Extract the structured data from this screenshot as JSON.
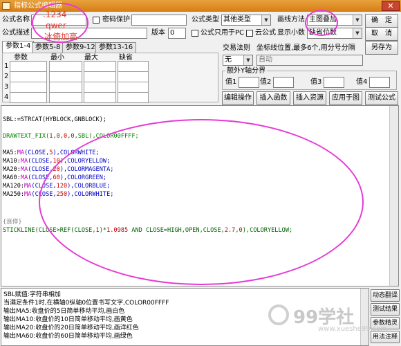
{
  "window": {
    "title": "指标公式编辑器",
    "close_label": "✕"
  },
  "header": {
    "name_label": "公式名称",
    "password_label": "密码保护",
    "desc_label": "公式描述",
    "version_label": "版本",
    "version_value": "0",
    "type_label": "公式类型",
    "type_value": "其他类型",
    "draw_label": "画线方法",
    "draw_value": "主图叠加",
    "pc_only_label": "公式只用于PC",
    "cloud_label": "云公式",
    "decimals_label": "显示小数",
    "decimals_value": "缺省位数",
    "ok_label": "确　定",
    "cancel_label": "取　消",
    "save_as_label": "另存为"
  },
  "params": {
    "tabs": [
      "参数1-4",
      "参数5-8",
      "参数9-12",
      "参数13-16"
    ],
    "headers": [
      "参数",
      "最小",
      "最大",
      "缺省"
    ],
    "rows": [
      "1",
      "2",
      "3",
      "4"
    ]
  },
  "trade": {
    "rule_label": "交易法则",
    "rule_value": "无",
    "coord_label": "坐标线位置,最多6个,用分号分隔",
    "coord_value": "自动",
    "extra_y_label": "额外Y轴分界",
    "value_labels": [
      "值1",
      "值2",
      "值3",
      "值4"
    ]
  },
  "toolbar": {
    "edit_ops": "编辑操作",
    "insert_func": "插入函数",
    "insert_res": "插入资源",
    "apply_chart": "应用于图",
    "test_formula": "测试公式"
  },
  "overlay": {
    "line1": ".1234",
    "line2": "qwer",
    "line3": "冰倚加高"
  },
  "code": {
    "l1": "SBL:=STRCAT(HYBLOCK,GNBLOCK);",
    "l2": [
      [
        "DRAWTEXT_FIX(",
        "green"
      ],
      [
        "1",
        "red"
      ],
      [
        ",",
        "green"
      ],
      [
        "0",
        "red"
      ],
      [
        ",",
        "green"
      ],
      [
        "0",
        "red"
      ],
      [
        ",",
        "green"
      ],
      [
        "0",
        "red"
      ],
      [
        ",SBL),COLOR00FFFF;",
        "green"
      ]
    ],
    "ma": [
      [
        [
          "MA5:",
          "black"
        ],
        [
          "MA",
          "mag"
        ],
        [
          "(CLOSE,",
          "blue"
        ],
        [
          "5",
          "red"
        ],
        [
          "),COLORWHITE;",
          "blue"
        ]
      ],
      [
        [
          "MA10:",
          "black"
        ],
        [
          "MA",
          "mag"
        ],
        [
          "(CLOSE,",
          "blue"
        ],
        [
          "10",
          "red"
        ],
        [
          "),COLORYELLOW;",
          "blue"
        ]
      ],
      [
        [
          "MA20:",
          "black"
        ],
        [
          "MA",
          "mag"
        ],
        [
          "(CLOSE,",
          "blue"
        ],
        [
          "20",
          "red"
        ],
        [
          "),COLORMAGENTA;",
          "blue"
        ]
      ],
      [
        [
          "MA60:",
          "black"
        ],
        [
          "MA",
          "mag"
        ],
        [
          "(CLOSE,",
          "blue"
        ],
        [
          "60",
          "red"
        ],
        [
          "),COLORGREEN;",
          "blue"
        ]
      ],
      [
        [
          "MA120:",
          "black"
        ],
        [
          "MA",
          "mag"
        ],
        [
          "(CLOSE,",
          "blue"
        ],
        [
          "120",
          "red"
        ],
        [
          "),COLORBLUE;",
          "blue"
        ]
      ],
      [
        [
          "MA250:",
          "black"
        ],
        [
          "MA",
          "mag"
        ],
        [
          "(CLOSE,",
          "blue"
        ],
        [
          "250",
          "red"
        ],
        [
          "),COLORWHITE;",
          "blue"
        ]
      ]
    ],
    "comment": "{涨停}",
    "last": [
      [
        "STICKLINE(CLOSE>REF(CLOSE,",
        "dkgreen"
      ],
      [
        "1",
        "red"
      ],
      [
        ")*",
        "dkgreen"
      ],
      [
        "1.0985",
        "red"
      ],
      [
        " AND CLOSE=HIGH,OPEN,CLOSE,",
        "dkgreen"
      ],
      [
        "2.7",
        "red"
      ],
      [
        ",",
        "dkgreen"
      ],
      [
        "0",
        "red"
      ],
      [
        "),COLORYELLOW;",
        "dkgreen"
      ]
    ]
  },
  "info": {
    "lines": [
      "SBL赋值:字符串相加",
      "当满足条件1时,在横轴0纵轴0位置书写文字,COLOR00FFFF",
      "输出MA5:收盘价的5日简单移动平均,画白色",
      "输出MA10:收盘价的10日简单移动平均,画黄色",
      "输出MA20:收盘价的20日简单移动平均,画洋红色",
      "输出MA60:收盘价的60日简单移动平均,画绿色"
    ]
  },
  "side_buttons": [
    "动态翻译",
    "测试结果",
    "参数精灵",
    "用法注释"
  ],
  "watermark": {
    "brand": "99学社",
    "url": "www.xueshe99.com"
  },
  "colors": {
    "title_bar": "#d67d14",
    "highlight_oval": "#e63ad6",
    "overlay_text": "#e8382c"
  }
}
